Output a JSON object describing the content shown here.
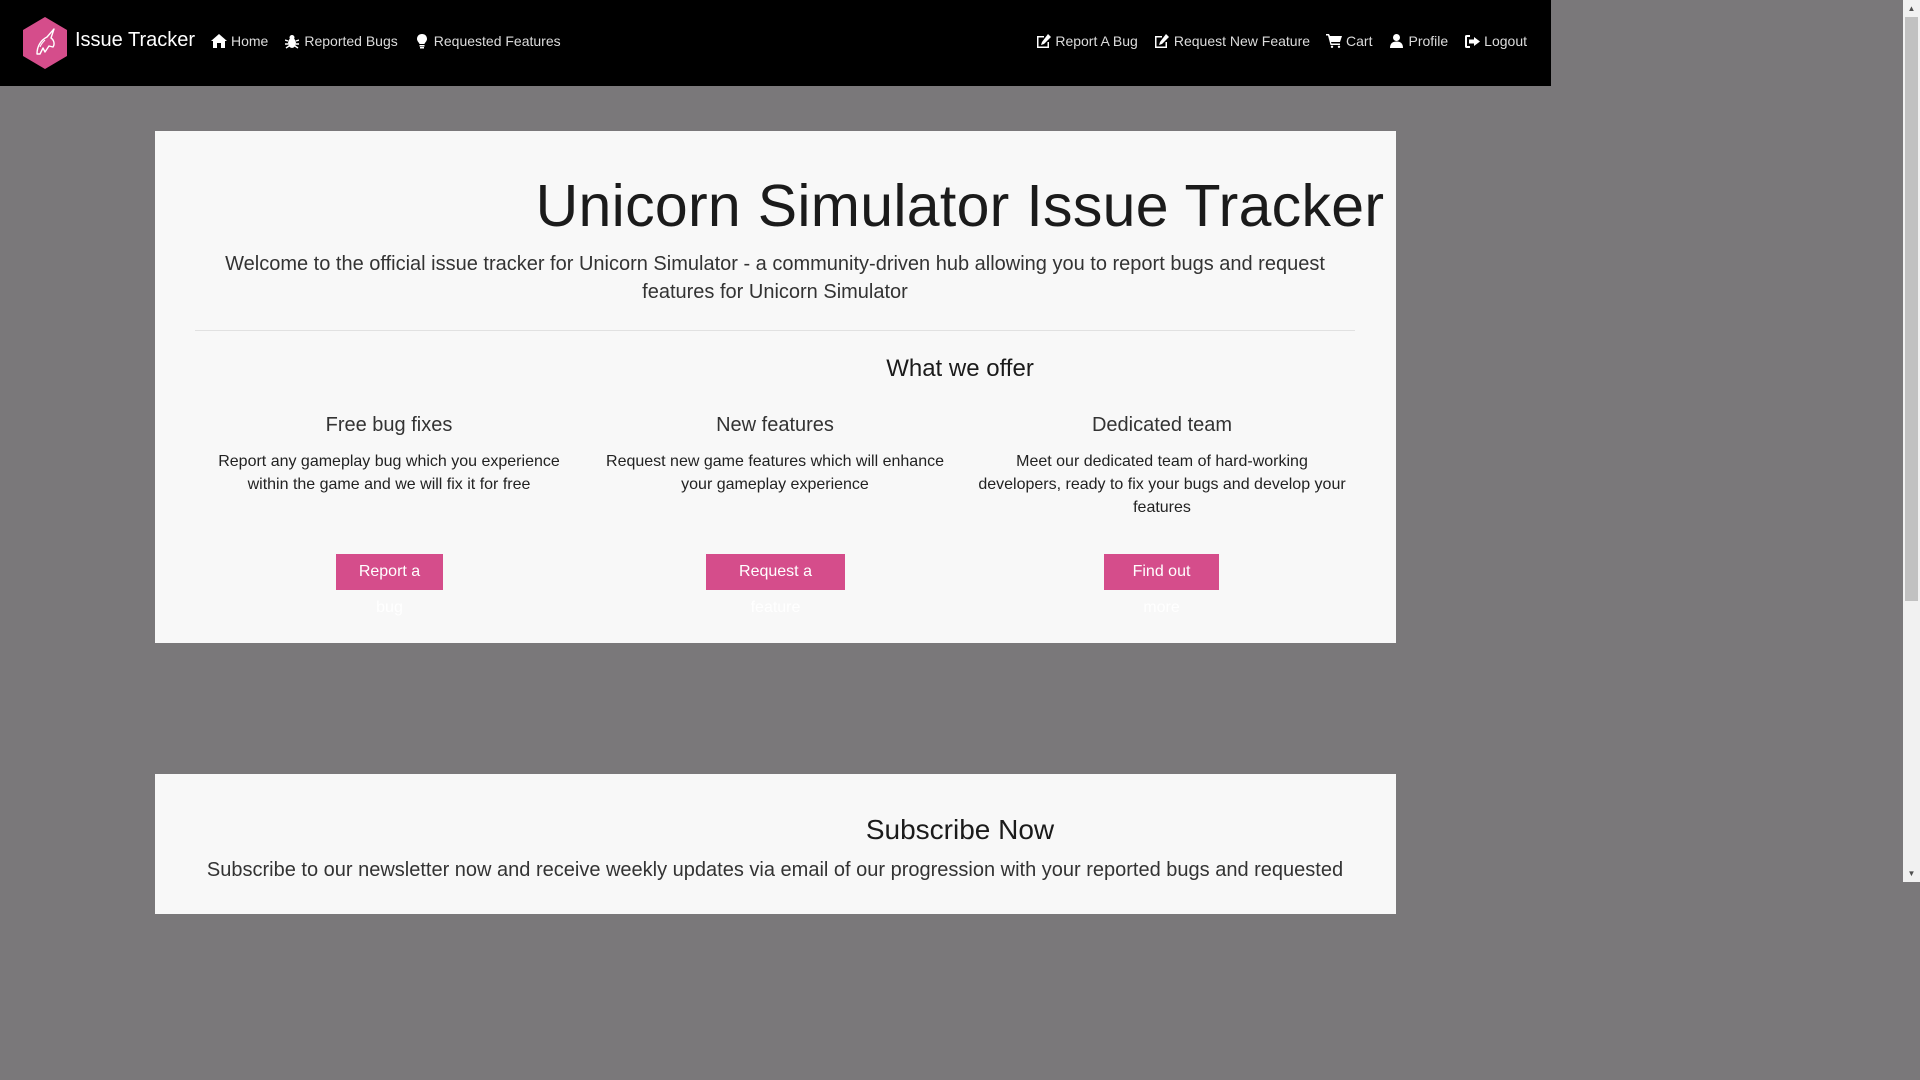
{
  "navbar": {
    "brand": "Issue Tracker",
    "brand_logo_icon": "unicorn-hexagon-logo",
    "left_items": [
      {
        "label": "Home",
        "icon": "home-icon"
      },
      {
        "label": "Reported Bugs",
        "icon": "bug-icon"
      },
      {
        "label": "Requested Features",
        "icon": "lightbulb-icon"
      }
    ],
    "right_items": [
      {
        "label": "Report A Bug",
        "icon": "edit-icon"
      },
      {
        "label": "Request New Feature",
        "icon": "edit-icon"
      },
      {
        "label": "Cart",
        "icon": "cart-icon"
      },
      {
        "label": "Profile",
        "icon": "user-icon"
      },
      {
        "label": "Logout",
        "icon": "logout-icon"
      }
    ]
  },
  "hero": {
    "title": "Unicorn Simulator Issue Tracker",
    "lead": "Welcome to the official issue tracker for Unicorn Simulator - a community-driven hub allowing you to report bugs and request features for Unicorn Simulator",
    "offer_heading": "What we offer",
    "columns": [
      {
        "heading": "Free bug fixes",
        "text": "Report any gameplay bug which you experience within the game and we will fix it for free",
        "button": "Report a bug"
      },
      {
        "heading": "New features",
        "text": "Request new game features which will enhance your gameplay experience",
        "button": "Request a feature"
      },
      {
        "heading": "Dedicated team",
        "text": "Meet our dedicated team of hard-working developers, ready to fix your bugs and develop your features",
        "button": "Find out more"
      }
    ]
  },
  "subscribe": {
    "title": "Subscribe Now",
    "text": "Subscribe to our newsletter now and receive weekly updates via email of our progression with your reported bugs and requested"
  },
  "colors": {
    "accent": "#d54d8b",
    "navbar_bg": "#000000",
    "page_bg": "#7a787a",
    "panel_bg": "#f8f8f8"
  }
}
